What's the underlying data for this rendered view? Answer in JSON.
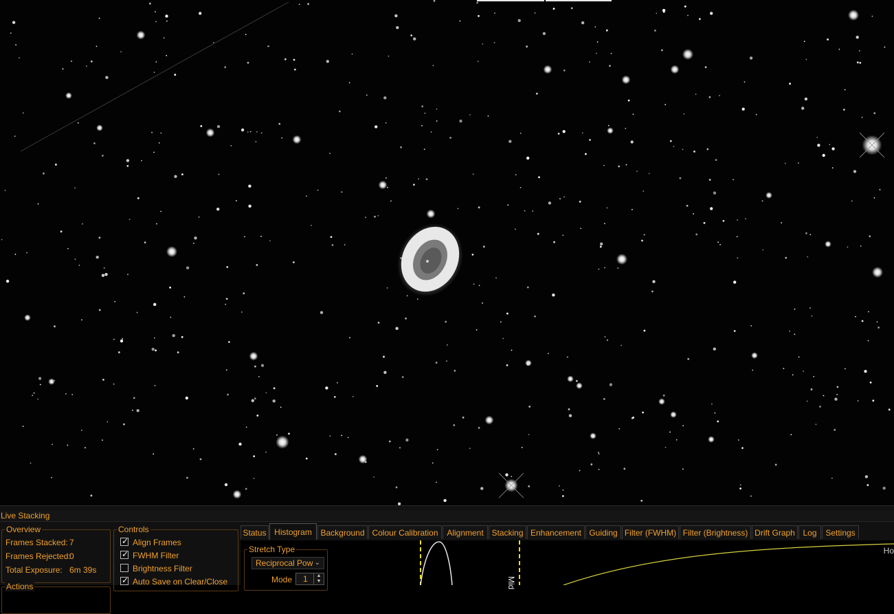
{
  "theme": {
    "accent": "#f0a030",
    "curve": "#d8d040",
    "marker": "#e8e020"
  },
  "panel": {
    "title": "Live Stacking"
  },
  "overview": {
    "legend": "Overview",
    "frames_stacked_label": "Frames Stacked:",
    "frames_stacked_value": "7",
    "frames_rejected_label": "Frames Rejected:",
    "frames_rejected_value": "0",
    "total_exposure_label": "Total Exposure:",
    "total_exposure_value": "6m 39s"
  },
  "actions": {
    "legend": "Actions"
  },
  "controls": {
    "legend": "Controls",
    "items": [
      {
        "label": "Align Frames",
        "checked": true
      },
      {
        "label": "FWHM Filter",
        "checked": true
      },
      {
        "label": "Brightness Filter",
        "checked": false
      },
      {
        "label": "Auto Save on Clear/Close",
        "checked": true
      }
    ]
  },
  "tabs": [
    {
      "label": "Status",
      "active": false
    },
    {
      "label": "Histogram",
      "active": true
    },
    {
      "label": "Background",
      "active": false
    },
    {
      "label": "Colour Calibration",
      "active": false
    },
    {
      "label": "Alignment",
      "active": false
    },
    {
      "label": "Stacking",
      "active": false
    },
    {
      "label": "Enhancement",
      "active": false
    },
    {
      "label": "Guiding",
      "active": false
    },
    {
      "label": "Filter (FWHM)",
      "active": false
    },
    {
      "label": "Filter (Brightness)",
      "active": false
    },
    {
      "label": "Drift Graph",
      "active": false
    },
    {
      "label": "Log",
      "active": false
    },
    {
      "label": "Settings",
      "active": false
    }
  ],
  "histogram": {
    "stretch_type_legend": "Stretch Type",
    "stretch_type_value": "Reciprocal Pow",
    "mode_label": "Mode",
    "mode_value": "1",
    "mid_label": "Mid",
    "corner_label": "Ho"
  }
}
